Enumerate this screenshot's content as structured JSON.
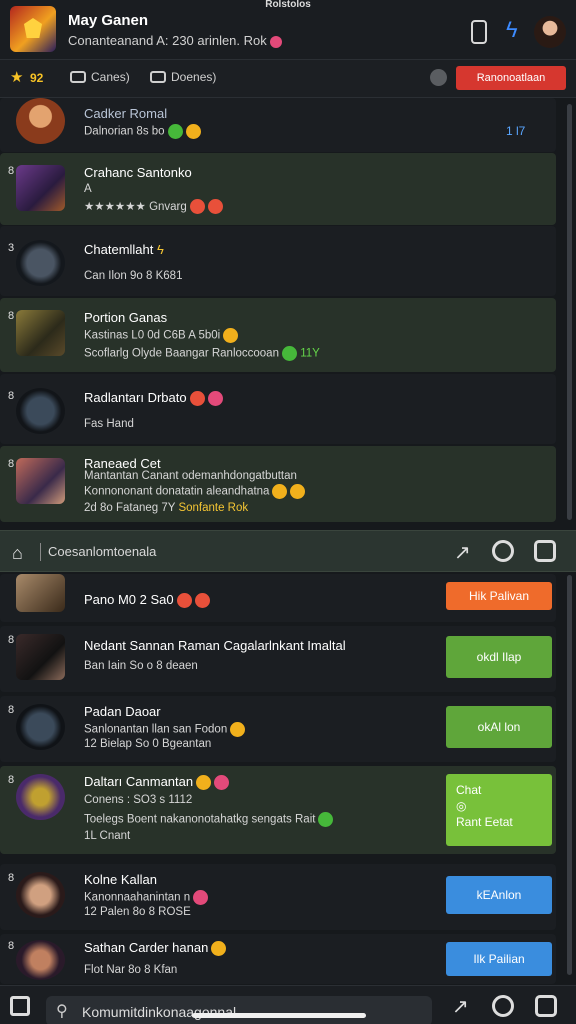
{
  "status_bar": {
    "text": "Rolstolos"
  },
  "header": {
    "title": "May Ganen",
    "subtitle": "Conanteanand A: 230 arinlen. Rok"
  },
  "toolbar": {
    "rating": "92",
    "games_label": "Canes)",
    "chat_label": "Doenes)",
    "red_button": "Ranonoatlaan"
  },
  "list_top": [
    {
      "l1": "Cadker Romal",
      "l2": "Dalnorian 8s bo",
      "l3": "",
      "right": "1 l7"
    },
    {
      "num": "8",
      "l1": "Crahanc Santonko",
      "l2": "A",
      "l3": "Gnvarg"
    },
    {
      "num": "3",
      "l1": "Chatemllaht",
      "l2": "",
      "l3": "Can Ilon 9o 8 K681"
    },
    {
      "num": "8",
      "l1": "Portion Ganas",
      "l2": "Kastinas L0 0d C6B A 5b0i",
      "l3": "Scoflarlg Olyde Baangar Ranloccooan",
      "l3b": "11Y"
    },
    {
      "num": "8",
      "l1": "Radlantarı Drbato",
      "l2": "",
      "l3": "Fas Hand"
    },
    {
      "num": "8",
      "l1": "Raneaed Cet",
      "l2": "Mantantan Canant odemanhdongatbuttan",
      "l2b": "Konnononant donatatin aleandhatna",
      "l3": "2d 8o Fataneg 7Y",
      "l3b": "Sonfante Rok"
    }
  ],
  "action_bar": {
    "label": "Coesanlomtoenala"
  },
  "list_bottom": [
    {
      "l1": "Pano M0 2 Sa0",
      "button": "Hik Palivan"
    },
    {
      "num": "8",
      "l1": "Nedant Sannan Raman Cagalarlnkant Imaltal",
      "l2": "Ban Iain So o 8 deaen",
      "button": "okdl Ilap"
    },
    {
      "num": "8",
      "l1": "Padan Daoar",
      "l2": "Sanlonantan llan san Fodon",
      "l3": "12 Bielap So 0 Bgeantan",
      "button": "okAl lon"
    },
    {
      "num": "8",
      "l1": "Daltarı Canmantan",
      "l2": "Conens : SO3 s 1112",
      "l3": "Toelegs Boent nakanonotahatkg sengats Rait",
      "l4": "1L Cnant",
      "button_top": "Chat",
      "button_bottom": "Rant Eetat"
    },
    {
      "num": "8",
      "l1": "Kolne Kallan",
      "l2": "Kanonnaahanintan n",
      "l3": "12 Palen 8o 8 ROSE",
      "button": "kEAnlon"
    },
    {
      "num": "8",
      "l1": "Sathan Carder hanan",
      "l2": "Flot Nar 8o 8 Kfan",
      "button": "Ilk Pailian"
    }
  ],
  "bottom_bar": {
    "search": "Komumitdinkonaagonnal"
  }
}
